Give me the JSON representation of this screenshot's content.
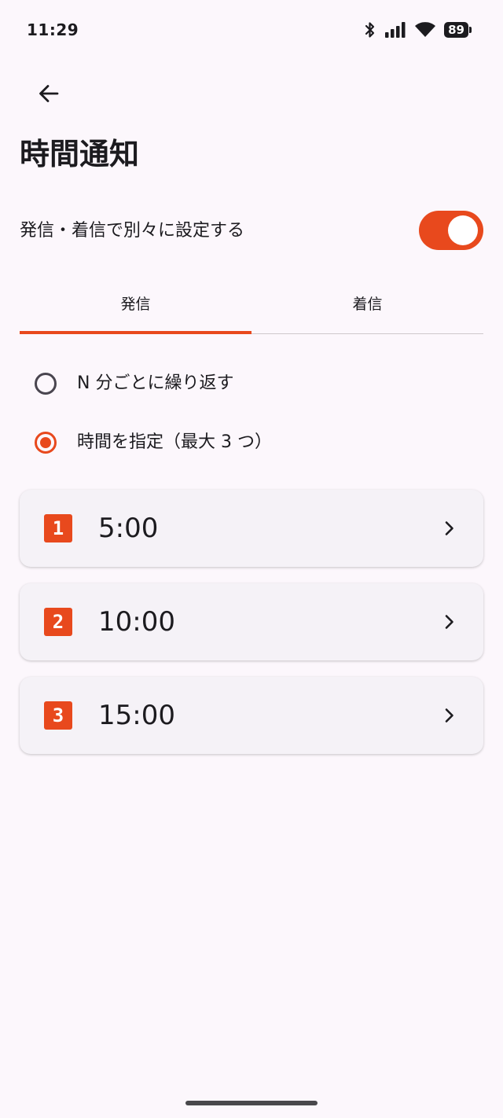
{
  "status_bar": {
    "time": "11:29",
    "battery": "89",
    "icons": [
      "bluetooth-icon",
      "signal-icon",
      "wifi-icon",
      "battery-icon"
    ]
  },
  "header": {
    "back_icon": "arrow-left-icon",
    "title": "時間通知"
  },
  "separate_setting": {
    "label": "発信・着信で別々に設定する",
    "enabled": true
  },
  "tabs": [
    {
      "label": "発信",
      "active": true
    },
    {
      "label": "着信",
      "active": false
    }
  ],
  "mode_options": [
    {
      "label": "N 分ごとに繰り返す",
      "selected": false
    },
    {
      "label": "時間を指定（最大 3 つ）",
      "selected": true
    }
  ],
  "times": [
    {
      "number": "1",
      "time": "5:00"
    },
    {
      "number": "2",
      "time": "10:00"
    },
    {
      "number": "3",
      "time": "15:00"
    }
  ],
  "colors": {
    "accent": "#e8491d",
    "background": "#fcf7fc",
    "card": "#f5f2f7",
    "text": "#1c1b1f"
  }
}
